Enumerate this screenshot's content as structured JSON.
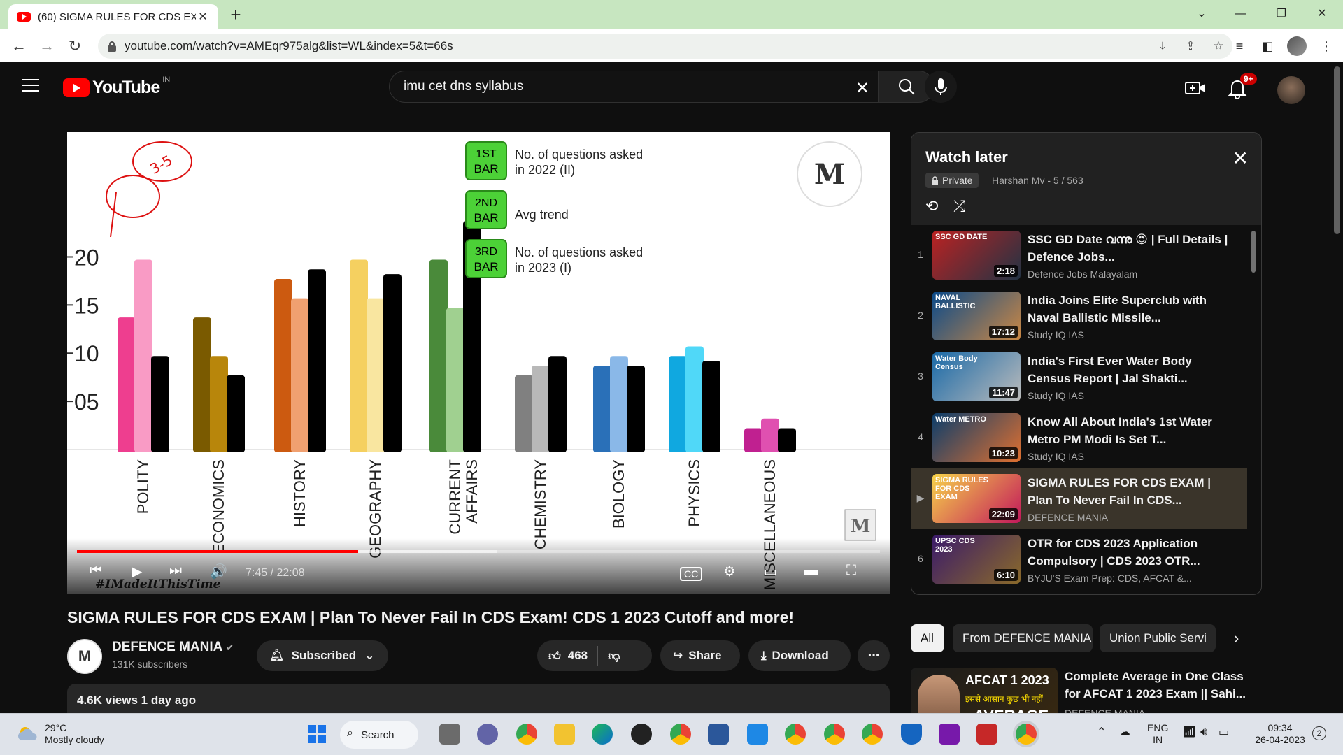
{
  "browser": {
    "tab_title": "(60) SIGMA RULES FOR CDS EXAM",
    "url": "youtube.com/watch?v=AMEqr975alg&list=WL&index=5&t=66s"
  },
  "youtube": {
    "country": "IN",
    "logo_text": "YouTube",
    "search_value": "imu cet dns syllabus",
    "notif_count": "9+"
  },
  "player": {
    "time": "7:45 / 22:08",
    "progress": 0.35,
    "watermark": "#IMadeItThisTime"
  },
  "video": {
    "title": "SIGMA RULES FOR CDS EXAM | Plan To Never Fail In CDS Exam! CDS 1 2023 Cutoff and more!",
    "channel": "DEFENCE MANIA",
    "subs": "131K subscribers",
    "subscribed_label": "Subscribed",
    "likes": "468",
    "share": "Share",
    "download": "Download",
    "views": "4.6K views  1 day ago",
    "channel_avatar": "M"
  },
  "playlist": {
    "title": "Watch later",
    "privacy": "Private",
    "meta": "Harshan Mv - 5 / 563",
    "items": [
      {
        "idx": "1",
        "title": "SSC GD Date വന്നു 😍 | Full Details | Defence Jobs...",
        "channel": "Defence Jobs Malayalam",
        "dur": "2:18",
        "thumb": "SSC GD DATE"
      },
      {
        "idx": "2",
        "title": "India Joins Elite Superclub with Naval Ballistic Missile...",
        "channel": "Study IQ IAS",
        "dur": "17:12",
        "thumb": "NAVAL BALLISTIC"
      },
      {
        "idx": "3",
        "title": "India's First Ever Water Body Census Report | Jal Shakti...",
        "channel": "Study IQ IAS",
        "dur": "11:47",
        "thumb": "Water Body Census"
      },
      {
        "idx": "4",
        "title": "Know All About India's 1st Water Metro PM Modi Is Set T...",
        "channel": "Study IQ IAS",
        "dur": "10:23",
        "thumb": "Water METRO"
      },
      {
        "idx": "▶",
        "title": "SIGMA RULES FOR CDS EXAM | Plan To Never Fail In CDS...",
        "channel": "DEFENCE MANIA",
        "dur": "22:09",
        "thumb": "SIGMA RULES FOR CDS EXAM"
      },
      {
        "idx": "6",
        "title": "OTR for CDS 2023 Application Compulsory | CDS 2023 OTR...",
        "channel": "BYJU'S Exam Prep: CDS, AFCAT &...",
        "dur": "6:10",
        "thumb": "UPSC CDS 2023"
      }
    ]
  },
  "chips": [
    "All",
    "From DEFENCE MANIA",
    "Union Public Servi"
  ],
  "recommendation": {
    "title": "Complete Average in One Class for AFCAT 1 2023 Exam || Sahi...",
    "channel": "DEFENCE MANIA",
    "thumb_top": "AFCAT 1 2023",
    "thumb_mid": "इससे आसान कुछ भी नहीं",
    "thumb_bottom": "AVERAGE"
  },
  "taskbar": {
    "temp": "29°C",
    "weather": "Mostly cloudy",
    "search": "Search",
    "lang1": "ENG",
    "lang2": "IN",
    "time": "09:34",
    "date": "26-04-2023",
    "notif": "2"
  },
  "chart_data": {
    "type": "bar",
    "ylim": [
      0,
      25
    ],
    "yticks": [
      "20",
      "15",
      "10",
      "05"
    ],
    "categories": [
      "POLITY",
      "ECONOMICS",
      "HISTORY",
      "GEOGRAPHY",
      "CURRENT AFFAIRS",
      "CHEMISTRY",
      "BIOLOGY",
      "PHYSICS",
      "MISCELLANEOUS"
    ],
    "series": [
      {
        "name": "No. of questions asked in 2022 (II)",
        "values": [
          14,
          14,
          18,
          20,
          20,
          8,
          9,
          10,
          2.5
        ]
      },
      {
        "name": "Avg trend",
        "values": [
          20,
          10,
          16,
          16,
          15,
          9,
          10,
          11,
          3.5
        ]
      },
      {
        "name": "No. of questions asked in 2023 (I)",
        "values": [
          10,
          8,
          19,
          18.5,
          24,
          10,
          9,
          9.5,
          2.5
        ]
      }
    ],
    "colors": [
      [
        "#ee3e8f",
        "#f99bc5",
        "#000000"
      ],
      [
        "#7a5a00",
        "#b8860b",
        "#000000"
      ],
      [
        "#cc5a10",
        "#f0a070",
        "#000000"
      ],
      [
        "#f5d060",
        "#f9e6a0",
        "#000000"
      ],
      [
        "#4a8a3a",
        "#a0d090",
        "#000000"
      ],
      [
        "#808080",
        "#b8b8b8",
        "#000000"
      ],
      [
        "#2a70b8",
        "#8ab8e8",
        "#000000"
      ],
      [
        "#10a8e0",
        "#50d8f8",
        "#000000"
      ],
      [
        "#c02090",
        "#e050b0",
        "#000000"
      ]
    ],
    "legend": [
      {
        "box": "1ST BAR",
        "label": "No. of questions asked in 2022 (II)"
      },
      {
        "box": "2ND BAR",
        "label": "Avg trend"
      },
      {
        "box": "3RD BAR",
        "label": "No. of questions asked in 2023 (I)"
      }
    ],
    "annotation": "3-5"
  }
}
